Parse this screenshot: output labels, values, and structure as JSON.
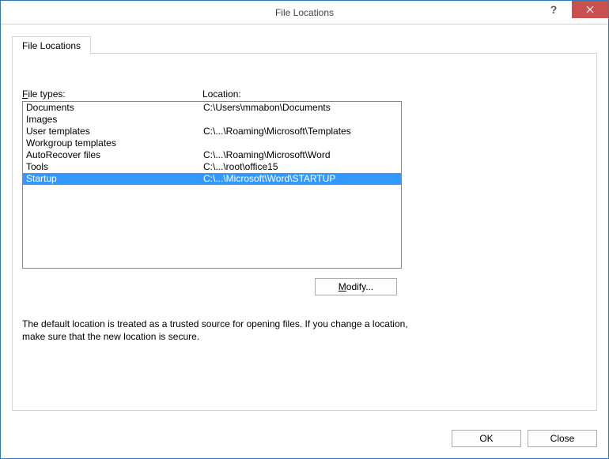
{
  "window": {
    "title": "File Locations"
  },
  "tab": {
    "label": "File Locations"
  },
  "headers": {
    "file_types_prefix": "F",
    "file_types_rest": "ile types:",
    "location": "Location:"
  },
  "rows": [
    {
      "type": "Documents",
      "location": "C:\\Users\\mmabon\\Documents",
      "selected": false
    },
    {
      "type": "Images",
      "location": "",
      "selected": false
    },
    {
      "type": "User templates",
      "location": "C:\\...\\Roaming\\Microsoft\\Templates",
      "selected": false
    },
    {
      "type": "Workgroup templates",
      "location": "",
      "selected": false
    },
    {
      "type": "AutoRecover files",
      "location": "C:\\...\\Roaming\\Microsoft\\Word",
      "selected": false
    },
    {
      "type": "Tools",
      "location": "C:\\...\\root\\office15",
      "selected": false
    },
    {
      "type": "Startup",
      "location": "C:\\...\\Microsoft\\Word\\STARTUP",
      "selected": true
    }
  ],
  "buttons": {
    "modify_prefix": "M",
    "modify_rest": "odify...",
    "ok": "OK",
    "close": "Close"
  },
  "note": "The default location is treated as a trusted source for opening files. If you change a location, make sure that the new location is secure."
}
